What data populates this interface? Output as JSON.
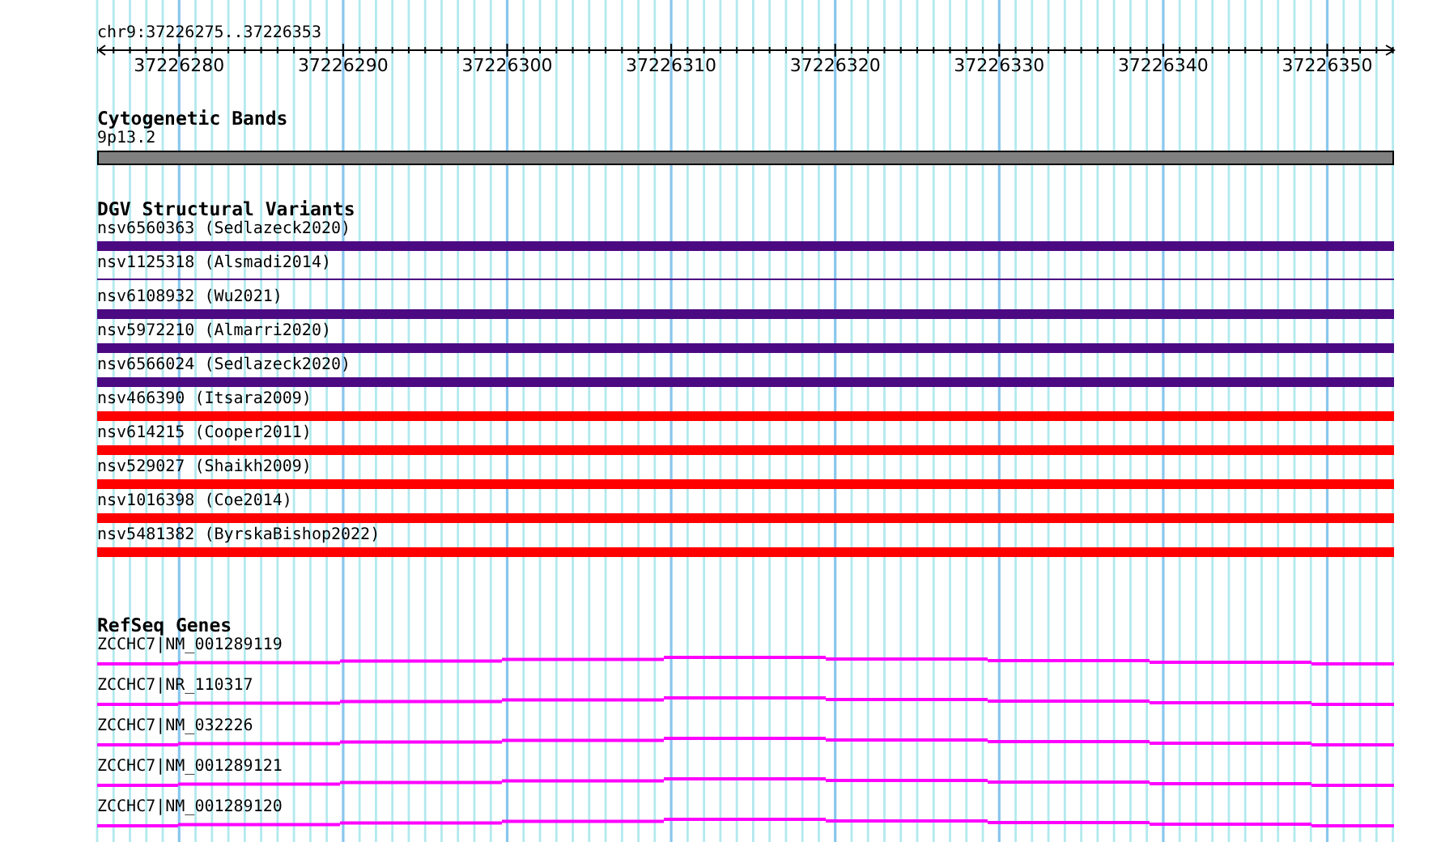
{
  "location": "chr9:37226275..37226353",
  "ruler": {
    "labels": [
      "37226280",
      "37226290",
      "37226300",
      "37226310",
      "37226320",
      "37226330",
      "37226340",
      "37226350"
    ]
  },
  "tracks": [
    {
      "kind": "bands",
      "title": "Cytogenetic Bands",
      "features": [
        {
          "label": "9p13.2"
        }
      ]
    },
    {
      "kind": "variants",
      "title": "DGV Structural Variants",
      "features": [
        {
          "label": "nsv6560363 (Sedlazeck2020)",
          "kind": "thick",
          "color": "#4b0a82"
        },
        {
          "label": "nsv1125318 (Alsmadi2014)",
          "kind": "thin",
          "color": "#4b0a82"
        },
        {
          "label": "nsv6108932 (Wu2021)",
          "kind": "thick",
          "color": "#4b0a82"
        },
        {
          "label": "nsv5972210 (Almarri2020)",
          "kind": "thick",
          "color": "#4b0a82"
        },
        {
          "label": "nsv6566024 (Sedlazeck2020)",
          "kind": "thick",
          "color": "#4b0a82"
        },
        {
          "label": "nsv466390 (Itsara2009)",
          "kind": "thick",
          "color": "#ff0000"
        },
        {
          "label": "nsv614215 (Cooper2011)",
          "kind": "thick",
          "color": "#ff0000"
        },
        {
          "label": "nsv529027 (Shaikh2009)",
          "kind": "thick",
          "color": "#ff0000"
        },
        {
          "label": "nsv1016398 (Coe2014)",
          "kind": "thick",
          "color": "#ff0000"
        },
        {
          "label": "nsv5481382 (ByrskaBishop2022)",
          "kind": "thick",
          "color": "#ff0000"
        }
      ]
    },
    {
      "kind": "genes",
      "title": "RefSeq Genes",
      "features": [
        {
          "label": "ZCCHC7|NM_001289119"
        },
        {
          "label": "ZCCHC7|NR_110317"
        },
        {
          "label": "ZCCHC7|NM_032226"
        },
        {
          "label": "ZCCHC7|NM_001289121"
        },
        {
          "label": "ZCCHC7|NM_001289120"
        }
      ]
    }
  ]
}
